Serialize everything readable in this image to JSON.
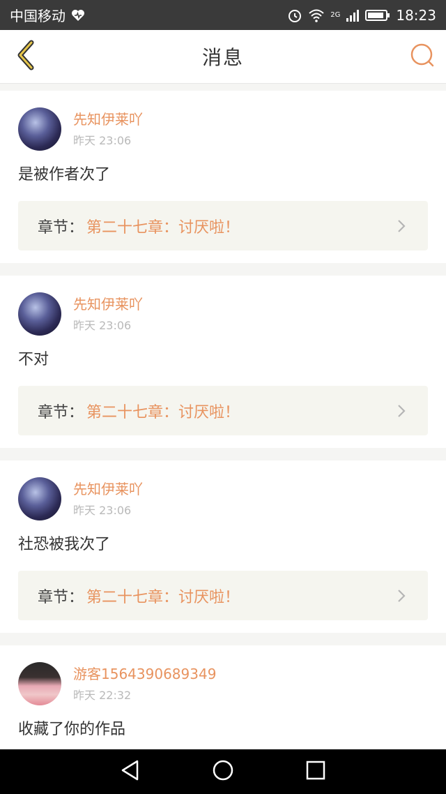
{
  "status_bar": {
    "carrier": "中国移动",
    "network": "2G",
    "time": "18:23",
    "icons": [
      "heart-icon",
      "alarm-icon",
      "wifi-icon",
      "signal-icon",
      "battery-icon"
    ]
  },
  "header": {
    "title": "消息",
    "back_icon": "back-chevron-icon",
    "search_icon": "search-icon",
    "accent": "#e8935f"
  },
  "messages": [
    {
      "username": "先知伊莱吖",
      "time": "昨天 23:06",
      "content": "是被作者次了",
      "chapter_prefix": "章节：",
      "chapter_title": "第二十七章：讨厌啦！"
    },
    {
      "username": "先知伊莱吖",
      "time": "昨天 23:06",
      "content": "不对",
      "chapter_prefix": "章节：",
      "chapter_title": "第二十七章：讨厌啦！"
    },
    {
      "username": "先知伊莱吖",
      "time": "昨天 23:06",
      "content": "社恐被我次了",
      "chapter_prefix": "章节：",
      "chapter_title": "第二十七章：讨厌啦！"
    },
    {
      "username": "游客1564390689349",
      "time": "昨天 22:32",
      "content": "收藏了你的作品"
    }
  ],
  "nav_bar": {
    "back_icon": "nav-back-icon",
    "home_icon": "nav-home-icon",
    "recent_icon": "nav-recent-icon"
  }
}
